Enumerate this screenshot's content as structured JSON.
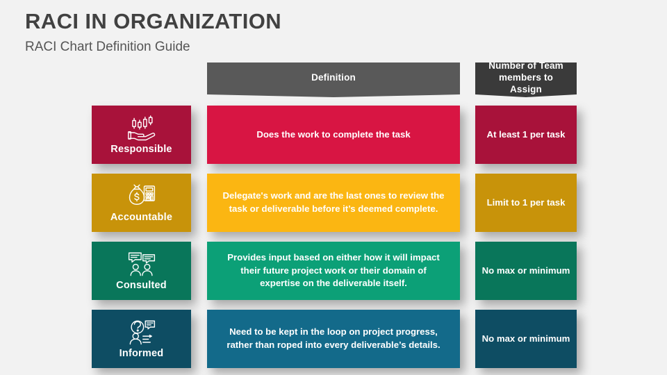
{
  "slide": {
    "background_color": "#f2f2f2",
    "title": "RACI IN ORGANIZATION",
    "subtitle": "RACI Chart Definition Guide"
  },
  "headers": {
    "definition": "Definition",
    "definition_color": "#595959",
    "count": "Number of Team members to Assign",
    "count_color": "#3a3a3a"
  },
  "rows": [
    {
      "key": "responsible",
      "label": "Responsible",
      "icon": "hand-holding-chart-icon",
      "definition": "Does the work to complete the task",
      "count": "At least 1 per task",
      "label_color": "#a8123a",
      "definition_color": "#d81543",
      "count_color": "#a8123a"
    },
    {
      "key": "accountable",
      "label": "Accountable",
      "icon": "money-bag-calculator-icon",
      "definition": "Delegate's work and are the last ones to review the task or deliverable before it’s deemed complete.",
      "count": "Limit to 1 per task",
      "label_color": "#c8930a",
      "definition_color": "#fbb612",
      "count_color": "#c8930a"
    },
    {
      "key": "consulted",
      "label": "Consulted",
      "icon": "two-people-speech-bubbles-icon",
      "definition": "Provides input based on either how it will impact their future project work or their domain of expertise on the deliverable itself.",
      "count": "No max or minimum",
      "label_color": "#09765a",
      "definition_color": "#0ca077",
      "count_color": "#09765a"
    },
    {
      "key": "informed",
      "label": "Informed",
      "icon": "person-message-icon",
      "definition": "Need to be kept in the loop on project progress, rather than roped into every deliverable’s details.",
      "count": "No max or minimum",
      "label_color": "#0e4d63",
      "definition_color": "#136a8a",
      "count_color": "#0e4d63"
    }
  ]
}
